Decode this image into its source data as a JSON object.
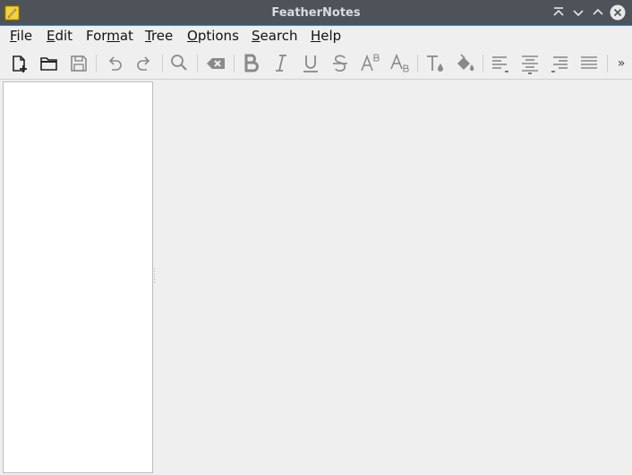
{
  "window": {
    "title": "FeatherNotes"
  },
  "menubar": {
    "items": [
      {
        "pre": "",
        "mnemonic": "F",
        "post": "ile"
      },
      {
        "pre": "",
        "mnemonic": "E",
        "post": "dit"
      },
      {
        "pre": "For",
        "mnemonic": "m",
        "post": "at"
      },
      {
        "pre": "",
        "mnemonic": "T",
        "post": "ree"
      },
      {
        "pre": "",
        "mnemonic": "O",
        "post": "ptions"
      },
      {
        "pre": "",
        "mnemonic": "S",
        "post": "earch"
      },
      {
        "pre": "",
        "mnemonic": "H",
        "post": "elp"
      }
    ]
  },
  "toolbar": {
    "overflow_label": "»",
    "icons": [
      "new-note-icon",
      "open-folder-icon",
      "save-icon",
      "undo-icon",
      "redo-icon",
      "search-icon",
      "clear-icon",
      "bold-icon",
      "italic-icon",
      "underline-icon",
      "strikethrough-icon",
      "superscript-icon",
      "subscript-icon",
      "text-color-icon",
      "background-color-icon",
      "align-left-icon",
      "align-center-icon",
      "align-right-icon",
      "align-justify-icon"
    ]
  },
  "colors": {
    "titlebar": "#4d5359",
    "titlebar_accent": "#3d8fd1",
    "background": "#efefef",
    "tree_background": "#ffffff"
  }
}
